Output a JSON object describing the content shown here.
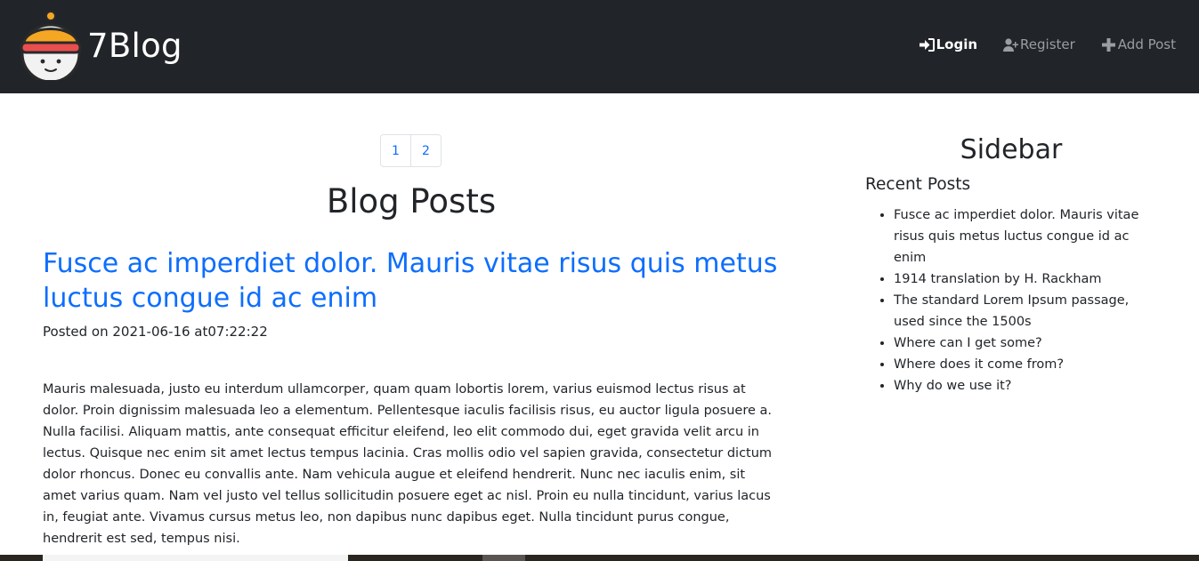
{
  "brand": {
    "name": "7Blog"
  },
  "nav": {
    "login": "Login",
    "register": "Register",
    "add_post": "Add Post"
  },
  "pagination": {
    "pages": [
      "1",
      "2"
    ]
  },
  "main": {
    "heading": "Blog Posts",
    "post": {
      "title": "Fusce ac imperdiet dolor. Mauris vitae risus quis metus luctus congue id ac enim",
      "meta": "Posted on 2021-06-16 at07:22:22",
      "body": "Mauris malesuada, justo eu interdum ullamcorper, quam quam lobortis lorem, varius euismod lectus risus at dolor. Proin dignissim malesuada leo a elementum. Pellentesque iaculis facilisis risus, eu auctor ligula posuere a. Nulla facilisi. Aliquam mattis, ante consequat efficitur eleifend, leo elit commodo dui, eget gravida velit arcu in lectus. Quisque nec enim sit amet lectus tempus lacinia. Cras mollis odio vel sapien gravida, consectetur dictum dolor rhoncus. Donec eu convallis ante. Nam vehicula augue et eleifend hendrerit. Nunc nec iaculis enim, sit amet varius quam. Nam vel justo vel tellus sollicitudin posuere eget ac nisl. Proin eu nulla tincidunt, varius lacus in, feugiat ante. Vivamus cursus metus leo, non dapibus nunc dapibus eget. Nulla tincidunt purus congue, hendrerit est sed, tempus nisi."
    }
  },
  "sidebar": {
    "title": "Sidebar",
    "recent_title": "Recent Posts",
    "recent_posts": [
      "Fusce ac imperdiet dolor. Mauris vitae risus quis metus luctus congue id ac enim",
      "1914 translation by H. Rackham",
      "The standard Lorem Ipsum passage, used since the 1500s",
      "Where can I get some?",
      "Where does it come from?",
      "Why do we use it?"
    ]
  },
  "colors": {
    "navbar_bg": "#212529",
    "link_blue": "#0d6efd",
    "nav_inactive": "#9a9da1",
    "logo_hat_orange": "#f5a623",
    "logo_hat_red": "#e94f4f"
  },
  "icons": {
    "login": "sign-in-icon",
    "register": "user-plus-icon",
    "add_post": "plus-icon"
  }
}
